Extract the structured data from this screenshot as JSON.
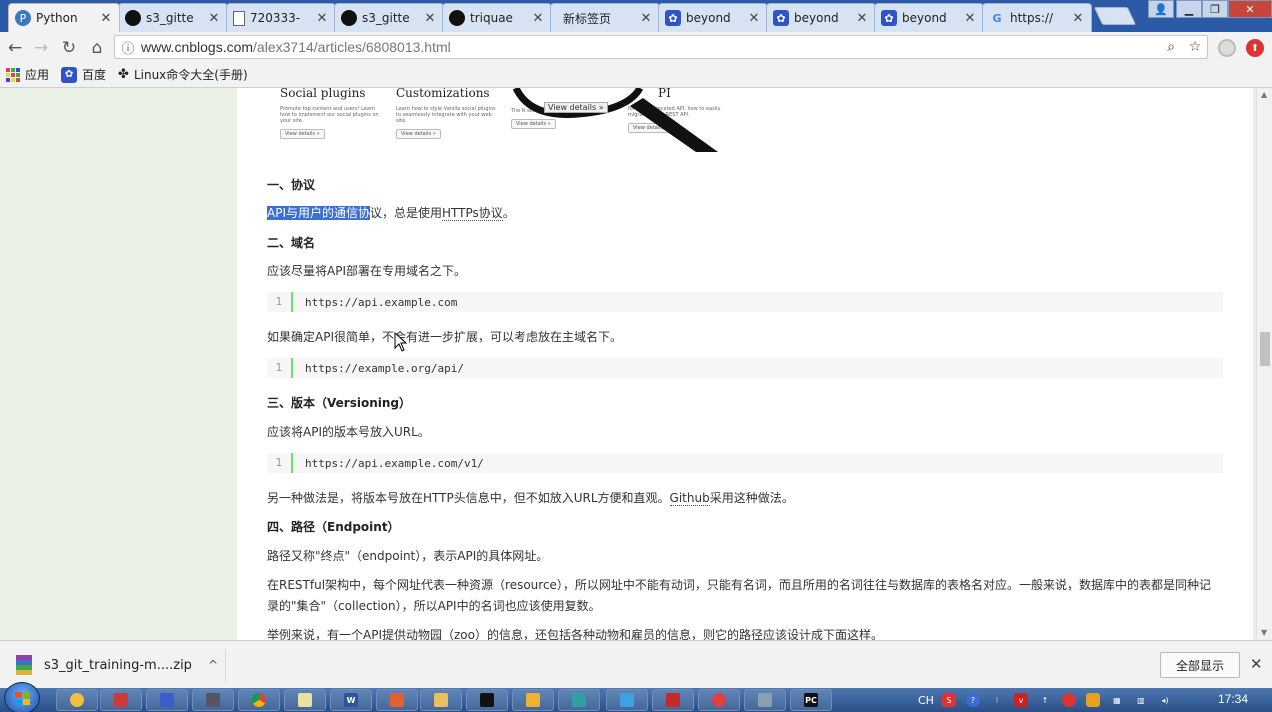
{
  "tabs": [
    {
      "label": "Python",
      "icon": "python-icon",
      "active": true
    },
    {
      "label": "s3_gitte",
      "icon": "github-icon"
    },
    {
      "label": "720333-",
      "icon": "document-icon"
    },
    {
      "label": "s3_gitte",
      "icon": "github-icon"
    },
    {
      "label": "triquae",
      "icon": "github-icon"
    },
    {
      "label": "新标签页",
      "icon": "none"
    },
    {
      "label": "beyond",
      "icon": "baidu-paw-icon"
    },
    {
      "label": "beyond",
      "icon": "baidu-paw-icon"
    },
    {
      "label": "beyond",
      "icon": "baidu-paw-icon"
    },
    {
      "label": "https://",
      "icon": "google-icon"
    }
  ],
  "address": {
    "host": "www.cnblogs.com",
    "path": "/alex3714/articles/6808013.html"
  },
  "bookmarks": [
    {
      "label": "应用",
      "icon": "apps-grid-icon"
    },
    {
      "label": "百度",
      "icon": "baidu-paw-icon"
    },
    {
      "label": "Linux命令大全(手册)",
      "icon": "linux-icon"
    }
  ],
  "preview": {
    "cards": [
      {
        "title": "Social plugins",
        "text": "Promote top content and users! Learn how to implement our social plugins on your site.",
        "button": "View details »"
      },
      {
        "title": "Customizations",
        "text": "Learn how to style Vanilla social plugins to seamlessly integrate with your web site.",
        "button": "View details »"
      },
      {
        "title": "",
        "text": "The R services fr HTTP calls.",
        "button": "View details »"
      },
      {
        "title": "PI",
        "text": "for our deprecated API. how to easily migrate to our REST API.",
        "button": "View details »"
      }
    ],
    "magnifier_button": "View details »"
  },
  "article": {
    "s1_heading": "一、协议",
    "s1_selected": "API与用户的通信协",
    "s1_rest_a": "议，总是使用",
    "s1_link": "HTTPs协议",
    "s1_rest_b": "。",
    "s2_heading": "二、域名",
    "s2_p1": "应该尽量将API部署在专用域名之下。",
    "s2_code1_line": "1",
    "s2_code1": "https://api.example.com",
    "s2_p2": "如果确定API很简单，不会有进一步扩展，可以考虑放在主域名下。",
    "s2_code2_line": "1",
    "s2_code2": "https://example.org/api/",
    "s3_heading": "三、版本（Versioning）",
    "s3_p1": "应该将API的版本号放入URL。",
    "s3_code_line": "1",
    "s3_code": "https://api.example.com/v1/",
    "s3_p2_a": "另一种做法是，将版本号放在HTTP头信息中，但不如放入URL方便和直观。",
    "s3_link": "Github",
    "s3_p2_b": "采用这种做法。",
    "s4_heading": "四、路径（Endpoint）",
    "s4_p1": "路径又称\"终点\"（endpoint），表示API的具体网址。",
    "s4_p2_l1": "在RESTful架构中，每个网址代表一种资源（resource），所以网址中不能有动词，只能有名词，而且所用的名词往往与数据库的表格名对应。一般来说，数据库中的表都是同种记",
    "s4_p2_l2": "录的\"集合\"（collection），所以API中的名词也应该使用复数。",
    "s4_p3": "举例来说，有一个API提供动物园（zoo）的信息，还包括各种动物和雇员的信息，则它的路径应该设计成下面这样。"
  },
  "download": {
    "filename": "s3_git_training-m....zip",
    "show_all": "全部显示"
  },
  "tray": {
    "lang": "CH",
    "time": "17:34"
  },
  "colors": {
    "selection": "#3b6fd6",
    "tabstrip": "#2b5aa6",
    "page_bg": "#e8f1e4",
    "code_gutter": "#6ce26c"
  }
}
